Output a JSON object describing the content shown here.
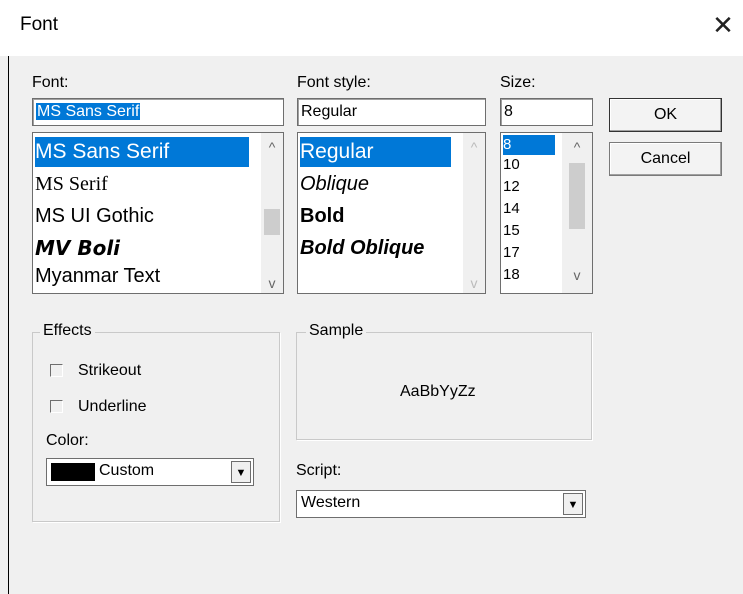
{
  "window": {
    "title": "Font",
    "close_glyph": "✕"
  },
  "font": {
    "label": "Font:",
    "value": "MS Sans Serif",
    "items": [
      "MS Sans Serif",
      "MS Serif",
      "MS UI Gothic",
      "MV Boli",
      "Myanmar Text"
    ],
    "selected_index": 0
  },
  "style": {
    "label": "Font style:",
    "value": "Regular",
    "items": [
      "Regular",
      "Oblique",
      "Bold",
      "Bold Oblique"
    ],
    "selected_index": 0
  },
  "size": {
    "label": "Size:",
    "value": "8",
    "items": [
      "8",
      "10",
      "12",
      "14",
      "15",
      "17",
      "18"
    ],
    "selected_index": 0
  },
  "buttons": {
    "ok": "OK",
    "cancel": "Cancel"
  },
  "effects": {
    "title": "Effects",
    "strikeout": "Strikeout",
    "underline": "Underline",
    "strikeout_checked": false,
    "underline_checked": false,
    "color_label": "Color:",
    "color_value": "Custom",
    "color_swatch": "#000000"
  },
  "sample": {
    "title": "Sample",
    "text": "AaBbYyZz"
  },
  "script": {
    "label": "Script:",
    "value": "Western"
  },
  "scroll_arrows": {
    "up": "^",
    "down": "v",
    "dropdown": "▼"
  },
  "colors": {
    "selection": "#0078d7",
    "dialog_bg": "#f0f0f0"
  }
}
